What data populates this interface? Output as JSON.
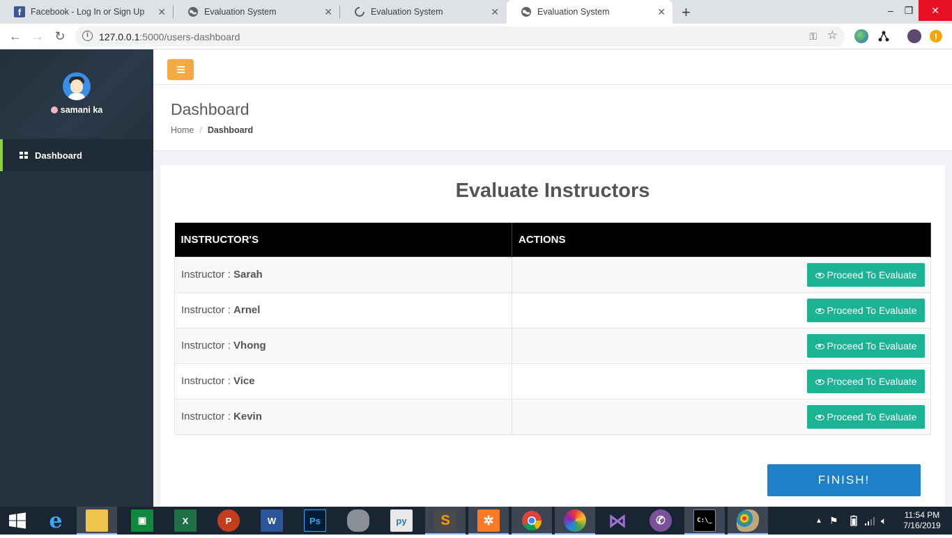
{
  "browser": {
    "tabs": [
      {
        "title": "Facebook - Log In or Sign Up",
        "icon": "facebook-icon"
      },
      {
        "title": "Evaluation System",
        "icon": "globe-icon"
      },
      {
        "title": "Evaluation System",
        "icon": "loading-icon"
      },
      {
        "title": "Evaluation System",
        "icon": "globe-icon"
      }
    ],
    "active_tab": 3,
    "url_host": "127.0.0.1",
    "url_path": ":5000/users-dashboard"
  },
  "sidebar": {
    "username": "samani ka",
    "items": [
      {
        "label": "Dashboard",
        "icon": "dashboard-grid-icon"
      }
    ]
  },
  "page": {
    "title": "Dashboard",
    "breadcrumb": [
      "Home",
      "Dashboard"
    ]
  },
  "panel": {
    "title": "Evaluate Instructors",
    "columns": [
      "INSTRUCTOR'S",
      "ACTIONS"
    ],
    "row_prefix": "Instructor : ",
    "rows": [
      {
        "name": "Sarah",
        "action": "Proceed To Evaluate"
      },
      {
        "name": "Arnel",
        "action": "Proceed To Evaluate"
      },
      {
        "name": "Vhong",
        "action": "Proceed To Evaluate"
      },
      {
        "name": "Vice",
        "action": "Proceed To Evaluate"
      },
      {
        "name": "Kevin",
        "action": "Proceed To Evaluate"
      }
    ],
    "finish_label": "FINISH!"
  },
  "colors": {
    "sidebar_bg": "#24323f",
    "accent_green": "#8ed03a",
    "hamburger_orange": "#f5a941",
    "evaluate_button": "#1cb394",
    "finish_button": "#1e80c8"
  },
  "taskbar": {
    "apps": [
      "windows-start-icon",
      "internet-explorer-icon",
      "file-explorer-icon",
      "store-icon",
      "excel-icon",
      "powerpoint-icon",
      "word-icon",
      "photoshop-icon",
      "database-icon",
      "python-icon",
      "sublime-text-icon",
      "xampp-icon",
      "chrome-icon",
      "app-icon",
      "visual-studio-icon",
      "viber-icon",
      "cmd-icon",
      "paint-icon"
    ],
    "time": "11:54 PM",
    "date": "7/16/2019"
  }
}
